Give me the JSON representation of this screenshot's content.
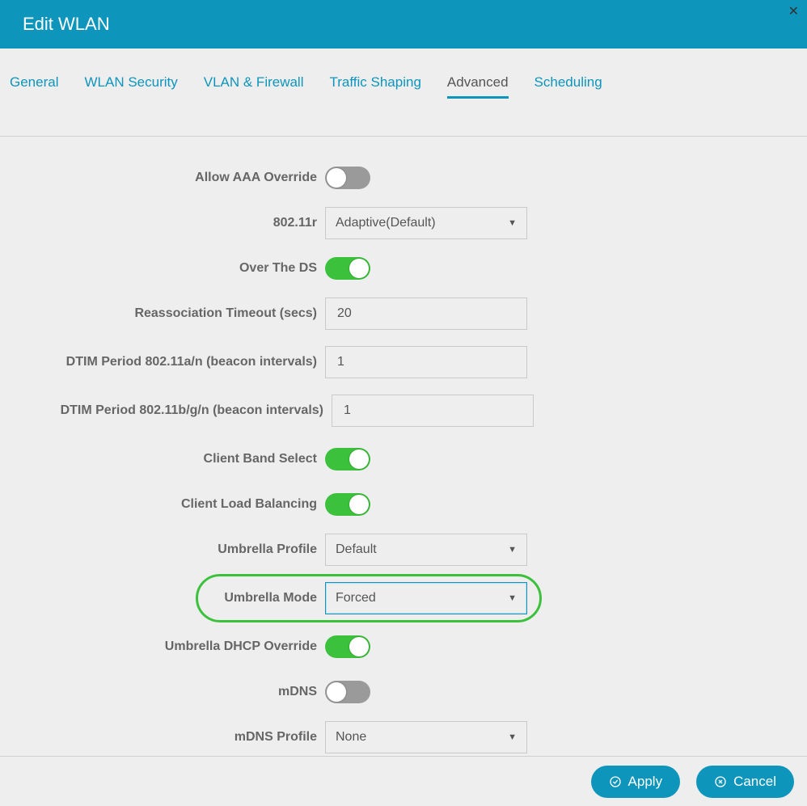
{
  "header": {
    "title": "Edit WLAN"
  },
  "tabs": [
    {
      "label": "General",
      "active": false
    },
    {
      "label": "WLAN Security",
      "active": false
    },
    {
      "label": "VLAN & Firewall",
      "active": false
    },
    {
      "label": "Traffic Shaping",
      "active": false
    },
    {
      "label": "Advanced",
      "active": true
    },
    {
      "label": "Scheduling",
      "active": false
    }
  ],
  "form": {
    "allow_aaa_override": {
      "label": "Allow AAA Override",
      "toggle": false
    },
    "r802_11r": {
      "label": "802.11r",
      "selected": "Adaptive(Default)"
    },
    "over_the_ds": {
      "label": "Over The DS",
      "toggle": true
    },
    "reassociation_timeout": {
      "label": "Reassociation Timeout (secs)",
      "value": "20"
    },
    "dtim_an": {
      "label": "DTIM Period 802.11a/n (beacon intervals)",
      "value": "1"
    },
    "dtim_bgn": {
      "label": "DTIM Period 802.11b/g/n (beacon intervals)",
      "value": "1"
    },
    "client_band_select": {
      "label": "Client Band Select",
      "toggle": true
    },
    "client_load_balancing": {
      "label": "Client Load Balancing",
      "toggle": true
    },
    "umbrella_profile": {
      "label": "Umbrella Profile",
      "selected": "Default"
    },
    "umbrella_mode": {
      "label": "Umbrella Mode",
      "selected": "Forced",
      "highlighted": true
    },
    "umbrella_dhcp_override": {
      "label": "Umbrella DHCP Override",
      "toggle": true
    },
    "mdns": {
      "label": "mDNS",
      "toggle": false
    },
    "mdns_profile": {
      "label": "mDNS Profile",
      "selected": "None"
    }
  },
  "footer": {
    "apply_label": "Apply",
    "cancel_label": "Cancel"
  }
}
